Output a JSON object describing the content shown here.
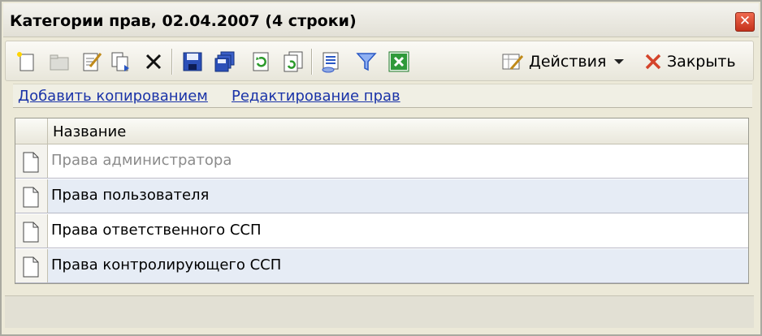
{
  "window": {
    "title": "Категории прав, 02.04.2007 (4 строки)",
    "close_glyph": "✕"
  },
  "toolbar": {
    "icons": [
      "new-document-icon",
      "open-folder-icon",
      "edit-icon",
      "copy-icon",
      "delete-icon",
      "save-icon",
      "save-all-icon",
      "refresh-icon",
      "refresh-all-icon",
      "report-icon",
      "filter-icon",
      "excel-icon"
    ],
    "actions_label": "Действия",
    "close_label": "Закрыть"
  },
  "links": {
    "add_copy": "Добавить копированием",
    "edit_rights": "Редактирование прав"
  },
  "grid": {
    "column_name": "Название",
    "rows": [
      {
        "name": "Права администратора",
        "disabled": true
      },
      {
        "name": "Права пользователя",
        "disabled": false
      },
      {
        "name": "Права ответственного ССП",
        "disabled": false
      },
      {
        "name": "Права контролирующего ССП",
        "disabled": false
      }
    ]
  },
  "colors": {
    "link": "#1a33a8",
    "row_alt": "#e6ecf5",
    "close_red": "#d4432a"
  }
}
